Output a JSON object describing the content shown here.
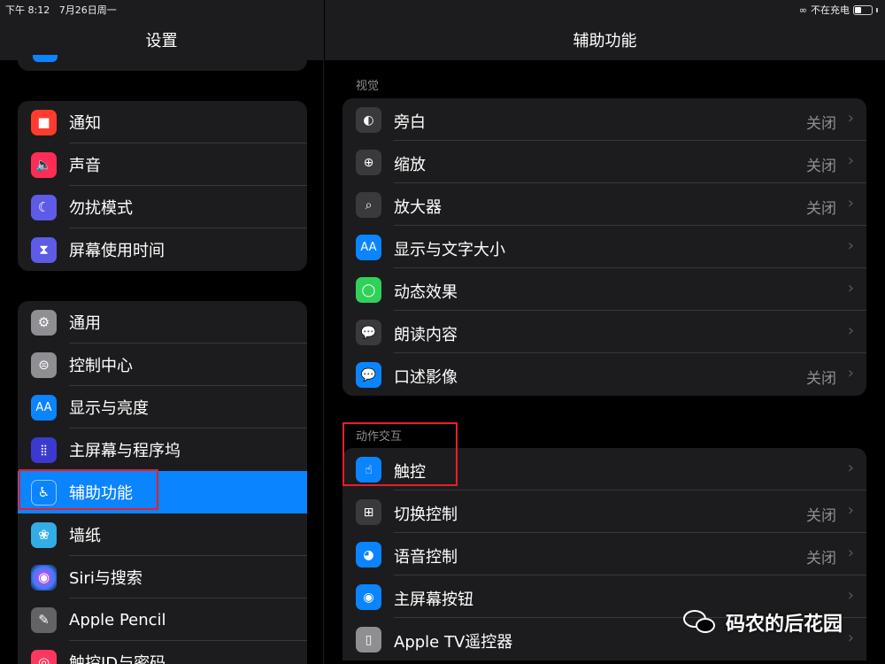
{
  "status_bar": {
    "time": "下午 8:12",
    "date": "7月26日周一",
    "charging": "不在充电"
  },
  "left": {
    "title": "设置",
    "group1": [
      {
        "label": "通知",
        "icon": "notification-icon",
        "color": "#ff3b30"
      },
      {
        "label": "声音",
        "icon": "speaker-icon",
        "color": "#ff2d55"
      },
      {
        "label": "勿扰模式",
        "icon": "moon-icon",
        "color": "#5e5ce6"
      },
      {
        "label": "屏幕使用时间",
        "icon": "hourglass-icon",
        "color": "#5e5ce6"
      }
    ],
    "group2": [
      {
        "label": "通用",
        "icon": "gear-icon",
        "color": "#8e8e93"
      },
      {
        "label": "控制中心",
        "icon": "toggles-icon",
        "color": "#8e8e93"
      },
      {
        "label": "显示与亮度",
        "icon": "text-size-icon",
        "color": "#0a84ff"
      },
      {
        "label": "主屏幕与程序坞",
        "icon": "home-grid-icon",
        "color": "#3a3ad0"
      },
      {
        "label": "辅助功能",
        "icon": "accessibility-icon",
        "color": "#0a84ff"
      },
      {
        "label": "墙纸",
        "icon": "flower-icon",
        "color": "#32ade6"
      },
      {
        "label": "Siri与搜索",
        "icon": "siri-icon",
        "color": "#222"
      },
      {
        "label": "Apple Pencil",
        "icon": "pencil-icon",
        "color": "#636366"
      },
      {
        "label": "触控ID与密码",
        "icon": "fingerprint-icon",
        "color": "#ff375f"
      }
    ]
  },
  "right": {
    "title": "辅助功能",
    "section_vision": "视觉",
    "vision_rows": [
      {
        "label": "旁白",
        "value": "关闭",
        "icon": "voiceover-icon",
        "color": "#3a3a3c"
      },
      {
        "label": "缩放",
        "value": "关闭",
        "icon": "zoom-icon",
        "color": "#3a3a3c"
      },
      {
        "label": "放大器",
        "value": "关闭",
        "icon": "magnifier-icon",
        "color": "#3a3a3c"
      },
      {
        "label": "显示与文字大小",
        "value": "",
        "icon": "text-size-icon",
        "color": "#0a84ff"
      },
      {
        "label": "动态效果",
        "value": "",
        "icon": "motion-icon",
        "color": "#30d158"
      },
      {
        "label": "朗读内容",
        "value": "",
        "icon": "speech-bubble-icon",
        "color": "#3a3a3c"
      },
      {
        "label": "口述影像",
        "value": "关闭",
        "icon": "audio-description-icon",
        "color": "#0a84ff"
      }
    ],
    "section_interaction": "动作交互",
    "interaction_rows": [
      {
        "label": "触控",
        "value": "",
        "icon": "hand-touch-icon",
        "color": "#0a84ff"
      },
      {
        "label": "切换控制",
        "value": "关闭",
        "icon": "switch-grid-icon",
        "color": "#3a3a3c"
      },
      {
        "label": "语音控制",
        "value": "关闭",
        "icon": "voice-control-icon",
        "color": "#0a84ff"
      },
      {
        "label": "主屏幕按钮",
        "value": "",
        "icon": "home-button-icon",
        "color": "#0a84ff"
      },
      {
        "label": "Apple TV遥控器",
        "value": "",
        "icon": "remote-icon",
        "color": "#8e8e93"
      }
    ]
  },
  "watermark": "码农的后花园"
}
